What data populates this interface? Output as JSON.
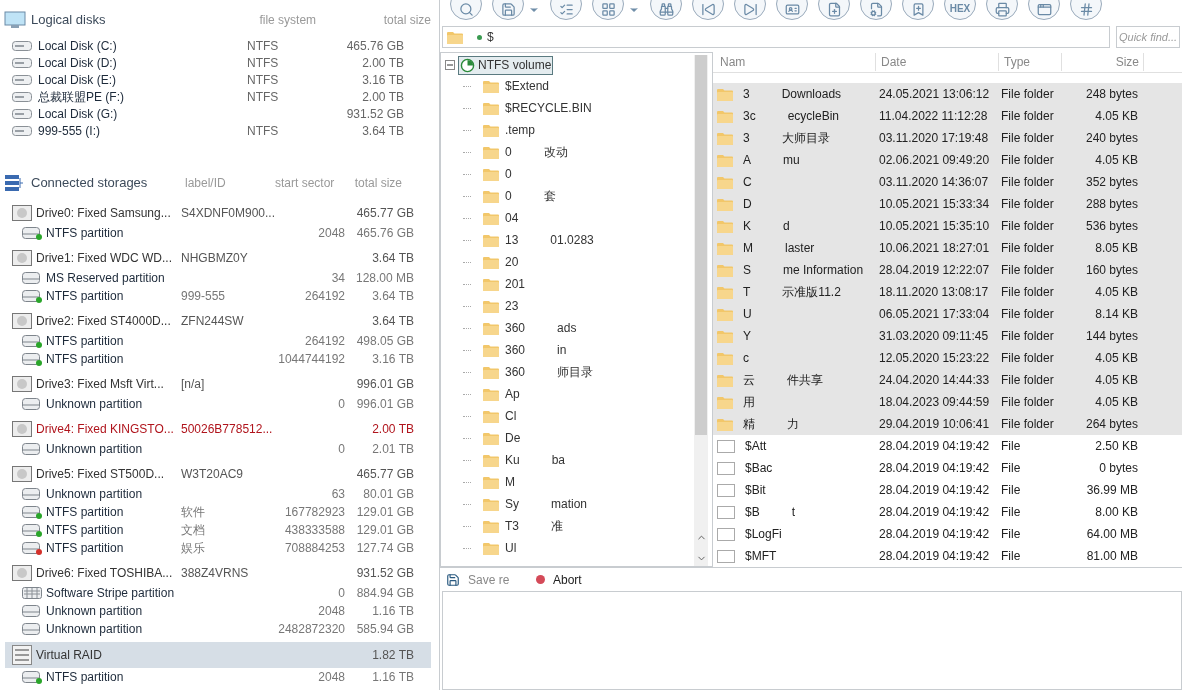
{
  "logical_disks": {
    "title": "Logical disks",
    "columns": [
      "file system",
      "total size"
    ],
    "rows": [
      {
        "name": "Local Disk (C:)",
        "fs": "NTFS",
        "size": "465.76 GB"
      },
      {
        "name": "Local Disk (D:)",
        "fs": "NTFS",
        "size": "2.00 TB"
      },
      {
        "name": "Local Disk (E:)",
        "fs": "NTFS",
        "size": "3.16 TB"
      },
      {
        "name": "总裁联盟PE (F:)",
        "fs": "NTFS",
        "size": "2.00 TB"
      },
      {
        "name": "Local Disk (G:)",
        "size": "931.52 GB"
      },
      {
        "name": "999-555 (I:)",
        "fs": "NTFS",
        "size": "3.64 TB"
      }
    ]
  },
  "storages": {
    "title": "Connected storages",
    "columns": [
      "label/ID",
      "start sector",
      "total size"
    ],
    "rows": [
      {
        "kind": "drive",
        "name": "Drive0: Fixed Samsung...",
        "label": "S4XDNF0M900...",
        "size": "465.77 GB",
        "warning": false,
        "selected": false
      },
      {
        "kind": "partition",
        "color": "#2aa52a",
        "name": "NTFS partition",
        "start": "2048",
        "size": "465.76 GB"
      },
      {
        "kind": "drive",
        "name": "Drive1: Fixed WDC WD...",
        "label": "NHGBMZ0Y",
        "size": "3.64 TB",
        "warning": false,
        "selected": false
      },
      {
        "kind": "partition",
        "name": "MS Reserved partition",
        "start": "34",
        "size": "128.00 MB"
      },
      {
        "kind": "partition",
        "color": "#2aa52a",
        "name": "NTFS partition",
        "label": "999-555",
        "start": "264192",
        "size": "3.64 TB"
      },
      {
        "kind": "drive",
        "name": "Drive2: Fixed ST4000D...",
        "label": "ZFN244SW",
        "size": "3.64 TB",
        "warning": false,
        "selected": false
      },
      {
        "kind": "partition",
        "color": "#2aa52a",
        "name": "NTFS partition",
        "start": "264192",
        "size": "498.05 GB"
      },
      {
        "kind": "partition",
        "color": "#2aa52a",
        "name": "NTFS partition",
        "start": "1044744192",
        "size": "3.16 TB"
      },
      {
        "kind": "drive",
        "name": "Drive3: Fixed Msft Virt...",
        "label": "[n/a]",
        "size": "996.01 GB",
        "warning": false,
        "selected": false
      },
      {
        "kind": "partition",
        "name": "Unknown partition",
        "start": "0",
        "size": "996.01 GB"
      },
      {
        "kind": "drive",
        "name": "Drive4: Fixed KINGSTO...",
        "label": "50026B778512...",
        "size": "2.00 TB",
        "warning": true,
        "selected": false
      },
      {
        "kind": "partition",
        "name": "Unknown partition",
        "start": "0",
        "size": "2.01 TB"
      },
      {
        "kind": "drive",
        "name": "Drive5: Fixed ST500D...",
        "label": "W3T20AC9",
        "size": "465.77 GB",
        "warning": false,
        "selected": false
      },
      {
        "kind": "partition",
        "name": "Unknown partition",
        "start": "63",
        "size": "80.01 GB"
      },
      {
        "kind": "partition",
        "color": "#2aa52a",
        "name": "NTFS partition",
        "label": "软件",
        "start": "167782923",
        "size": "129.01 GB"
      },
      {
        "kind": "partition",
        "color": "#2aa52a",
        "name": "NTFS partition",
        "label": "文档",
        "start": "438333588",
        "size": "129.01 GB"
      },
      {
        "kind": "partition",
        "color": "#d4302a",
        "name": "NTFS partition",
        "label": "娱乐",
        "start": "708884253",
        "size": "127.74 GB"
      },
      {
        "kind": "drive",
        "name": "Drive6: Fixed TOSHIBA...",
        "label": "388Z4VRNS",
        "size": "931.52 GB",
        "warning": false,
        "selected": false
      },
      {
        "kind": "stripe",
        "name": "Software Stripe partition",
        "start": "0",
        "size": "884.94 GB"
      },
      {
        "kind": "partition",
        "name": "Unknown partition",
        "start": "2048",
        "size": "1.16 TB"
      },
      {
        "kind": "partition",
        "name": "Unknown partition",
        "start": "2482872320",
        "size": "585.94 GB"
      },
      {
        "kind": "raid",
        "name": "Virtual RAID",
        "size": "1.82 TB",
        "selected": true
      },
      {
        "kind": "partition",
        "color": "#2aa52a",
        "name": "NTFS partition",
        "start": "2048",
        "size": "1.16 TB"
      }
    ]
  },
  "toolbar": {
    "hex_label": "HEX"
  },
  "path": {
    "value": "$"
  },
  "quick_find": {
    "placeholder": "Quick find..."
  },
  "tree": {
    "root": {
      "label": "NTFS volume",
      "expanded": true,
      "selected": true
    },
    "children": [
      [
        "$Extend"
      ],
      [
        "$RECYCLE.BIN"
      ],
      [
        ".temp"
      ],
      [
        "0",
        "改动"
      ],
      [
        "0"
      ],
      [
        "0",
        "套"
      ],
      [
        "04"
      ],
      [
        "13",
        "01.0283"
      ],
      [
        "20"
      ],
      [
        "201"
      ],
      [
        "23"
      ],
      [
        "360",
        "ads"
      ],
      [
        "360",
        "in"
      ],
      [
        "360",
        "师目录"
      ],
      [
        "Ap"
      ],
      [
        "Cl"
      ],
      [
        "De"
      ],
      [
        "Ku",
        "ba"
      ],
      [
        "M"
      ],
      [
        "Sy",
        "mation"
      ],
      [
        "T3",
        "准"
      ],
      [
        "Ul"
      ]
    ]
  },
  "file_list": {
    "columns": [
      "Nam",
      "Date",
      "Type",
      "Size"
    ],
    "rows": [
      {
        "kind": "folder",
        "selected": true,
        "name": [
          "3",
          "Downloads"
        ],
        "date": "24.05.2021 13:06:12",
        "type": "File folder",
        "size": "248 bytes"
      },
      {
        "kind": "folder",
        "selected": true,
        "name": [
          "3c",
          "ecycleBin"
        ],
        "date": "11.04.2022 11:12:28",
        "type": "File folder",
        "size": "4.05 KB"
      },
      {
        "kind": "folder",
        "selected": true,
        "name": [
          "3",
          "大师目录"
        ],
        "date": "03.11.2020 17:19:48",
        "type": "File folder",
        "size": "240 bytes"
      },
      {
        "kind": "folder",
        "selected": true,
        "name": [
          "A",
          "mu"
        ],
        "date": "02.06.2021 09:49:20",
        "type": "File folder",
        "size": "4.05 KB"
      },
      {
        "kind": "folder",
        "selected": true,
        "name": [
          "C"
        ],
        "date": "03.11.2020 14:36:07",
        "type": "File folder",
        "size": "352 bytes"
      },
      {
        "kind": "folder",
        "selected": true,
        "name": [
          "D"
        ],
        "date": "10.05.2021 15:33:34",
        "type": "File folder",
        "size": "288 bytes"
      },
      {
        "kind": "folder",
        "selected": true,
        "name": [
          "K",
          "d"
        ],
        "date": "10.05.2021 15:35:10",
        "type": "File folder",
        "size": "536 bytes"
      },
      {
        "kind": "folder",
        "selected": true,
        "name": [
          "M",
          "laster"
        ],
        "date": "10.06.2021 18:27:01",
        "type": "File folder",
        "size": "8.05 KB"
      },
      {
        "kind": "folder",
        "selected": true,
        "name": [
          "S",
          "me Information"
        ],
        "date": "28.04.2019 12:22:07",
        "type": "File folder",
        "size": "160 bytes"
      },
      {
        "kind": "folder",
        "selected": true,
        "name": [
          "T",
          "示准版11.2"
        ],
        "date": "18.11.2020 13:08:17",
        "type": "File folder",
        "size": "4.05 KB"
      },
      {
        "kind": "folder",
        "selected": true,
        "name": [
          "U"
        ],
        "date": "06.05.2021 17:33:04",
        "type": "File folder",
        "size": "8.14 KB"
      },
      {
        "kind": "folder",
        "selected": true,
        "name": [
          "Y"
        ],
        "date": "31.03.2020 09:11:45",
        "type": "File folder",
        "size": "144 bytes"
      },
      {
        "kind": "folder",
        "selected": true,
        "name": [
          "c"
        ],
        "date": "12.05.2020 15:23:22",
        "type": "File folder",
        "size": "4.05 KB"
      },
      {
        "kind": "folder",
        "selected": true,
        "name": [
          "云",
          "件共享"
        ],
        "date": "24.04.2020 14:44:33",
        "type": "File folder",
        "size": "4.05 KB"
      },
      {
        "kind": "folder",
        "selected": true,
        "name": [
          "用"
        ],
        "date": "18.04.2023 09:44:59",
        "type": "File folder",
        "size": "4.05 KB"
      },
      {
        "kind": "folder",
        "selected": true,
        "name": [
          "精",
          "力"
        ],
        "date": "29.04.2019 10:06:41",
        "type": "File folder",
        "size": "264 bytes"
      },
      {
        "kind": "file",
        "selected": false,
        "name": [
          "$Att"
        ],
        "date": "28.04.2019 04:19:42",
        "type": "File",
        "size": "2.50 KB"
      },
      {
        "kind": "file",
        "selected": false,
        "name": [
          "$Bac"
        ],
        "date": "28.04.2019 04:19:42",
        "type": "File",
        "size": "0 bytes"
      },
      {
        "kind": "file",
        "selected": false,
        "name": [
          "$Bit"
        ],
        "date": "28.04.2019 04:19:42",
        "type": "File",
        "size": "36.99 MB"
      },
      {
        "kind": "file",
        "selected": false,
        "name": [
          "$B",
          "t"
        ],
        "date": "28.04.2019 04:19:42",
        "type": "File",
        "size": "8.00 KB"
      },
      {
        "kind": "file",
        "selected": false,
        "name": [
          "$LogFi"
        ],
        "date": "28.04.2019 04:19:42",
        "type": "File",
        "size": "64.00 MB"
      },
      {
        "kind": "file",
        "selected": false,
        "name": [
          "$MFT"
        ],
        "date": "28.04.2019 04:19:42",
        "type": "File",
        "size": "81.00 MB"
      }
    ]
  },
  "actions": [
    {
      "kind": "save",
      "label": "Save re"
    },
    {
      "kind": "abort",
      "label": "Abort"
    }
  ]
}
